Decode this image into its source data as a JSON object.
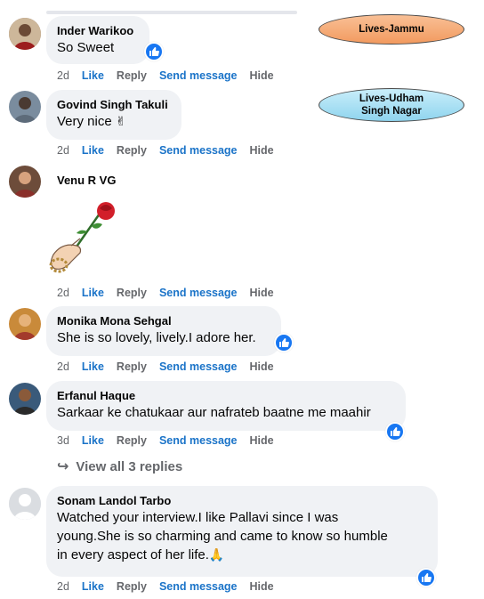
{
  "comments": [
    {
      "name": "Inder Warikoo",
      "text": "So Sweet",
      "time": "2d"
    },
    {
      "name": "Govind Singh Takuli",
      "text": "Very nice",
      "time": "2d"
    },
    {
      "name": "Venu R VG",
      "text": "",
      "time": "2d"
    },
    {
      "name": "Monika Mona Sehgal",
      "text": "She is so lovely, lively.I adore her.",
      "time": "2d"
    },
    {
      "name": "Erfanul Haque",
      "text": "Sarkaar ke chatukaar aur nafrateb baatne me maahir",
      "time": "3d"
    },
    {
      "name": "Sonam Landol Tarbo",
      "text_lines": [
        "Watched your interview.I like Pallavi since I was",
        "young.She is so charming and came to know so humble",
        "in every aspect of her life."
      ],
      "time": "2d"
    }
  ],
  "actions": {
    "like": "Like",
    "reply": "Reply",
    "send_message": "Send message",
    "hide": "Hide"
  },
  "view_replies": "View all 3 replies",
  "tags": {
    "jammu": "Lives-Jammu",
    "udham_line1": "Lives-Udham",
    "udham_line2": "Singh Nagar"
  },
  "colors": {
    "link_blue": "#1a73c8",
    "like_blue": "#1877f2",
    "bubble": "#f0f2f5",
    "tag_orange": "#f7a872",
    "tag_blue": "#a9e0f2"
  }
}
